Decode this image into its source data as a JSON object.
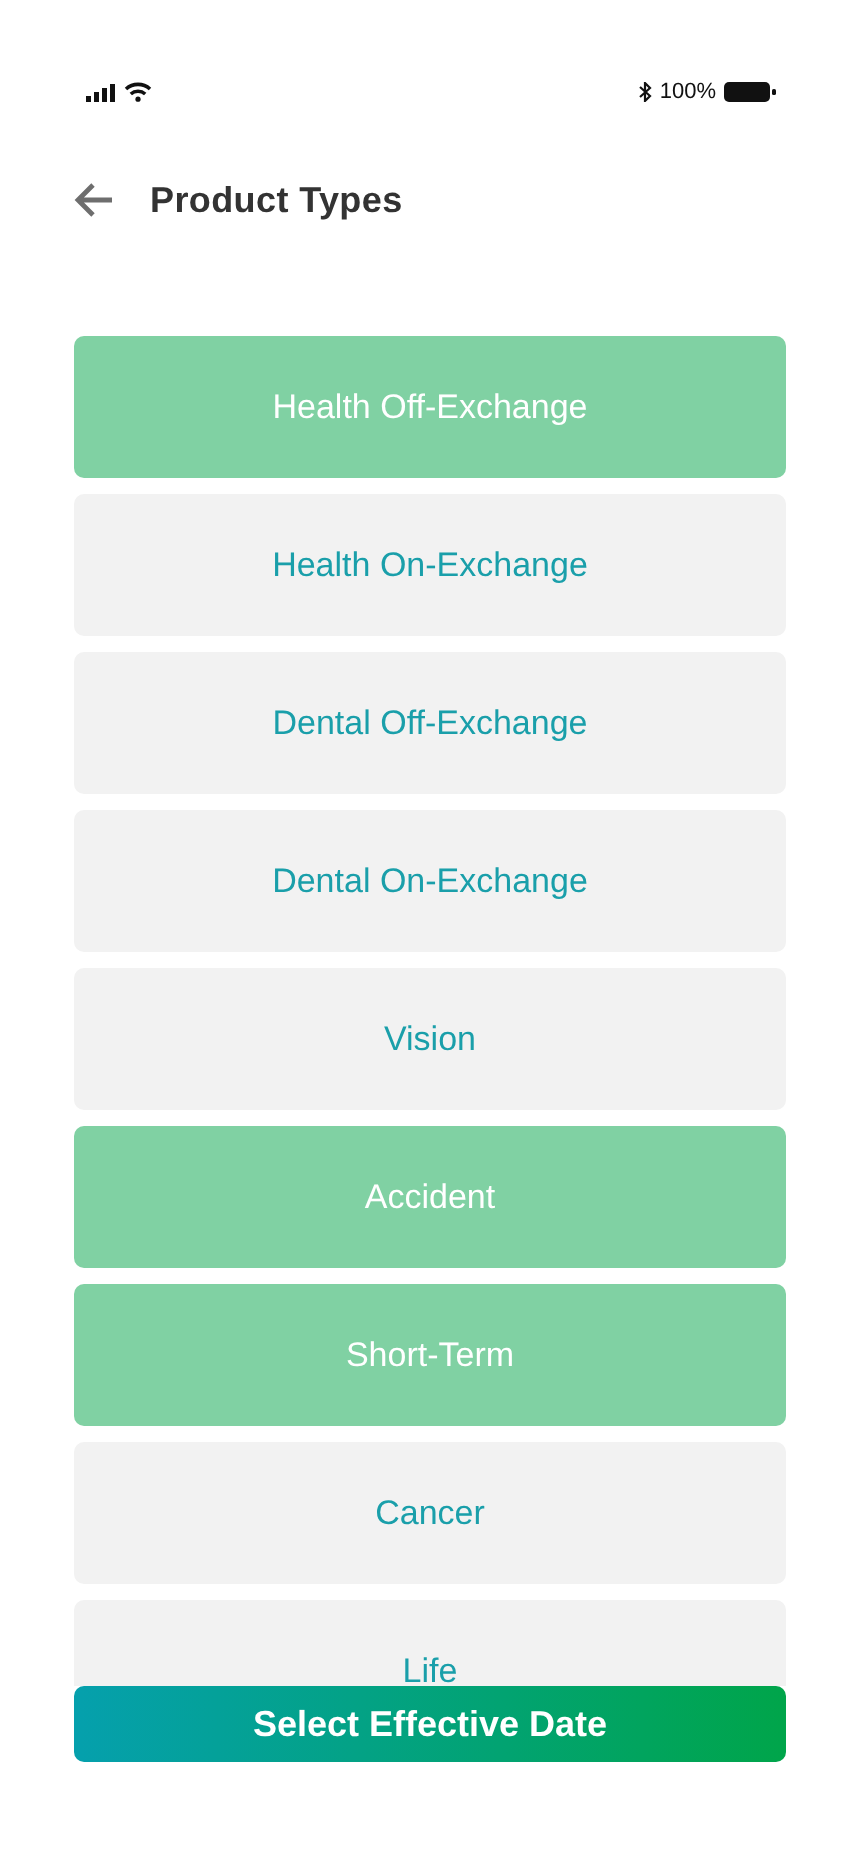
{
  "status_bar": {
    "battery_text": "100%"
  },
  "header": {
    "title": "Product Types"
  },
  "product_types": [
    {
      "label": "Health Off-Exchange",
      "selected": true
    },
    {
      "label": "Health On-Exchange",
      "selected": false
    },
    {
      "label": "Dental Off-Exchange",
      "selected": false
    },
    {
      "label": "Dental On-Exchange",
      "selected": false
    },
    {
      "label": "Vision",
      "selected": false
    },
    {
      "label": "Accident",
      "selected": true
    },
    {
      "label": "Short-Term",
      "selected": true
    },
    {
      "label": "Cancer",
      "selected": false
    },
    {
      "label": "Life",
      "selected": false
    }
  ],
  "action_button": {
    "label": "Select Effective Date"
  }
}
